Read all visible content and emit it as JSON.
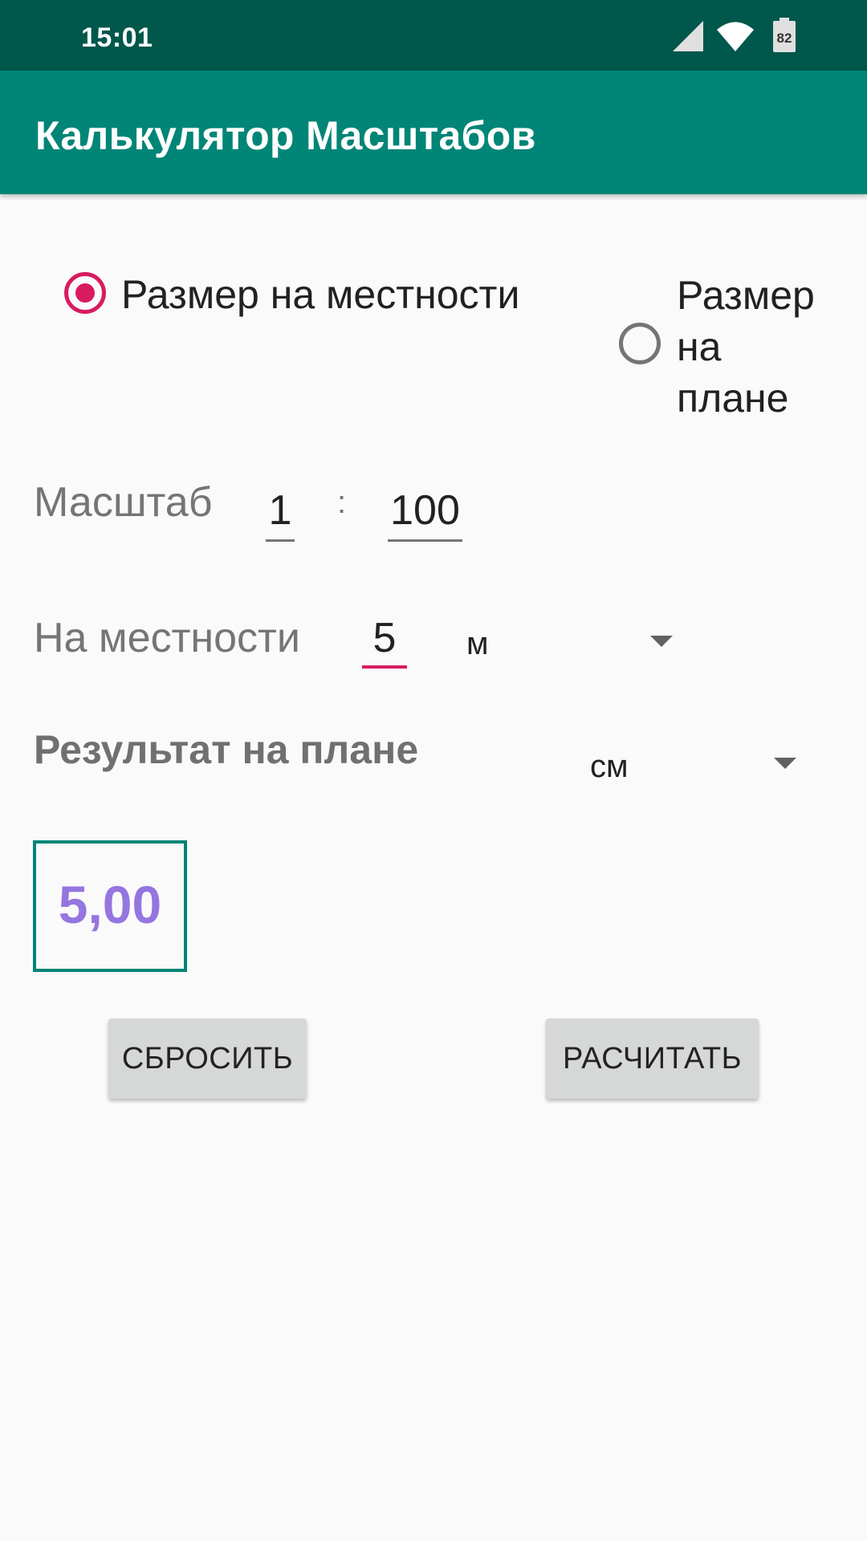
{
  "status_bar": {
    "time": "15:01",
    "battery": "82",
    "icons": [
      "cell-signal-icon",
      "wifi-icon",
      "battery-icon"
    ]
  },
  "app_bar": {
    "title": "Калькулятор Масштабов"
  },
  "mode": {
    "options": [
      {
        "label": "Размер на местности",
        "checked": true
      },
      {
        "label_lines": [
          "Размер",
          "на",
          "плане"
        ],
        "checked": false
      }
    ]
  },
  "scale": {
    "label": "Масштаб",
    "left": "1",
    "separator": ":",
    "right": "100"
  },
  "ground": {
    "label": "На местности",
    "value": "5",
    "unit": "м"
  },
  "result": {
    "label": "Результат на плане",
    "unit": "см",
    "value": "5,00"
  },
  "buttons": {
    "reset": "СБРОСИТЬ",
    "calculate": "РАСЧИТАТЬ"
  },
  "colors": {
    "primary": "#008577",
    "primary_dark": "#00574b",
    "accent": "#d81b60",
    "result_text": "#9575e0"
  }
}
